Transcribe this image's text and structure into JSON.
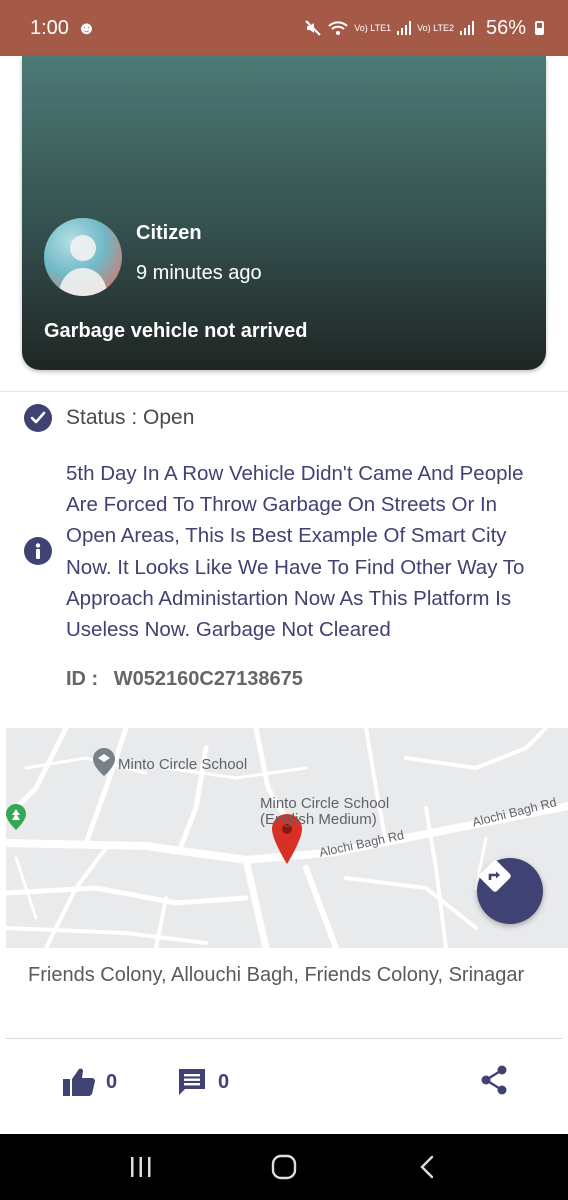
{
  "status_bar": {
    "time": "1:00",
    "accessibility_icon": "accessibility-person-icon",
    "network_1": "Vo) LTE1",
    "network_2": "Vo) LTE2",
    "battery": "56%"
  },
  "post": {
    "author": "Citizen",
    "time_ago": "9 minutes ago",
    "title": "Garbage vehicle not arrived",
    "status": "Status : Open",
    "description": "5th Day In A Row Vehicle Didn't Came And People Are Forced To Throw Garbage On Streets Or In Open Areas, This Is Best Example Of Smart City Now. It Looks Like We Have To Find Other Way To Approach Administartion Now As This Platform Is Useless Now. Garbage Not Cleared",
    "id_label": "ID :",
    "id_value": "W052160C27138675"
  },
  "map": {
    "labels": {
      "school_poi": "Minto Circle School",
      "school_full_line1": "Minto Circle School",
      "school_full_line2": "(English Medium)",
      "road_1": "Alochi Bagh Rd",
      "road_2": "Alochi Bagh Rd"
    },
    "colors": {
      "background": "#e9eaec",
      "roads": "#ffffff",
      "pin": "#d93025",
      "park": "#34a853"
    }
  },
  "address": "Friends Colony, Allouchi Bagh, Friends Colony, Srinagar",
  "actions": {
    "likes": "0",
    "comments": "0"
  },
  "colors": {
    "status_bar": "#a55a47",
    "accent": "#3f4272",
    "nav_bar": "#000000"
  }
}
